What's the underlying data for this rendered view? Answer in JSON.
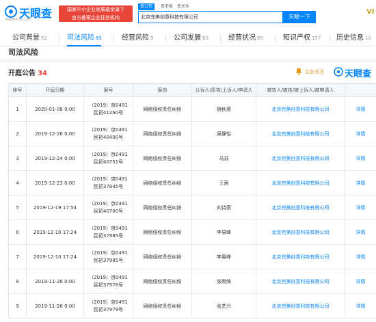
{
  "header": {
    "logo_text": "天眼查",
    "logo_sub": "TianYanCha.com",
    "badge_line1": "国家中小企业发展基金旗下",
    "badge_line2": "官方备案企业征信机构",
    "search_tabs": [
      "查公司",
      "查老板",
      "查关系"
    ],
    "search_value": "北京完美创意科技有限公司",
    "search_button": "天眼一下",
    "vip": "VI"
  },
  "nav": [
    {
      "label": "公司背景",
      "count": "52"
    },
    {
      "label": "司法风险",
      "count": "65"
    },
    {
      "label": "经营风险",
      "count": "9"
    },
    {
      "label": "公司发展",
      "count": "60"
    },
    {
      "label": "经营状况",
      "count": "69"
    },
    {
      "label": "知识产权",
      "count": "157"
    },
    {
      "label": "历史信息",
      "count": "10"
    }
  ],
  "section_title": "司法风险",
  "subsection": {
    "title": "开庭公告",
    "count": "34",
    "follow_label": "企业关注",
    "watermark": "天眼查"
  },
  "table": {
    "headers": [
      "序号",
      "开庭日期",
      "案号",
      "案由",
      "公诉人/原告/上诉人/申请人",
      "被告人/被告/被上诉人/被申请人",
      ""
    ],
    "rows": [
      {
        "no": "1",
        "date": "2020-01-08 0:00",
        "case1": "（2019）京0491",
        "case2": "民初41260号",
        "cause": "网络侵权责任纠纷",
        "plaintiff": "姚秋婆",
        "defendant": "北京完美创意科技有限公司",
        "action": "详情"
      },
      {
        "no": "2",
        "date": "2019-12-26 0:00",
        "case1": "（2019）京0491",
        "case2": "民初40400号",
        "cause": "网络侵权责任纠纷",
        "plaintiff": "吴静怡",
        "defendant": "北京完美创意科技有限公司",
        "action": "详情"
      },
      {
        "no": "3",
        "date": "2019-12-24 0:00",
        "case1": "（2019）京0491",
        "case2": "民初40751号",
        "cause": "网络侵权责任纠纷",
        "plaintiff": "马苏",
        "defendant": "北京完美创意科技有限公司",
        "action": "详情"
      },
      {
        "no": "4",
        "date": "2019-12-23 0:00",
        "case1": "（2019）京0491",
        "case2": "民初37845号",
        "cause": "网络侵权责任纠纷",
        "plaintiff": "王茜",
        "defendant": "北京完美创意科技有限公司",
        "action": "详情"
      },
      {
        "no": "5",
        "date": "2019-12-19 17:54",
        "case1": "（2019）京0491",
        "case2": "民初40700号",
        "cause": "网络侵权责任纠纷",
        "plaintiff": "刘诗雨",
        "defendant": "北京完美创意科技有限公司",
        "action": "详情"
      },
      {
        "no": "6",
        "date": "2019-12-10 17:24",
        "case1": "（2019）京0491",
        "case2": "民初37985号",
        "cause": "网络侵权责任纠纷",
        "plaintiff": "李易峰",
        "defendant": "北京完美创意科技有限公司",
        "action": "详情"
      },
      {
        "no": "7",
        "date": "2019-12-10 17:24",
        "case1": "（2019）京0491",
        "case2": "民初37985号",
        "cause": "网络侵权责任纠纷",
        "plaintiff": "李易峰",
        "defendant": "北京完美创意科技有限公司",
        "action": "详情"
      },
      {
        "no": "8",
        "date": "2019-11-26 0:00",
        "case1": "（2019）京0491",
        "case2": "民初37978号",
        "cause": "网络侵权责任纠纷",
        "plaintiff": "张雨绮",
        "defendant": "北京完美创意科技有限公司",
        "action": "详情"
      },
      {
        "no": "9",
        "date": "2019-11-26 0:00",
        "case1": "（2019）京0491",
        "case2": "民初37979号",
        "cause": "网络侵权责任纠纷",
        "plaintiff": "张艺兴",
        "defendant": "北京完美创意科技有限公司",
        "action": "详情"
      }
    ]
  },
  "colors": {
    "brand": "#0084ff",
    "badge": "#e8443a",
    "follow": "#e29a1e"
  }
}
